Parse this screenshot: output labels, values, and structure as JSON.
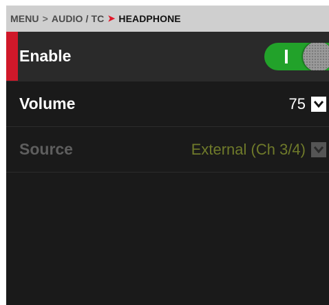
{
  "breadcrumb": {
    "items": [
      "MENU",
      "AUDIO / TC",
      "HEADPHONE"
    ],
    "separators": [
      ">",
      "➤"
    ]
  },
  "settings": {
    "enable": {
      "label": "Enable",
      "state": "on"
    },
    "volume": {
      "label": "Volume",
      "value": "75"
    },
    "source": {
      "label": "Source",
      "value": "External (Ch 3/4)",
      "enabled": false
    }
  },
  "colors": {
    "accent": "#d0182a",
    "toggle_on": "#22a22a",
    "disabled_value": "#6f7a2a"
  },
  "icons": {
    "dropdown": "chevron-down-icon"
  }
}
